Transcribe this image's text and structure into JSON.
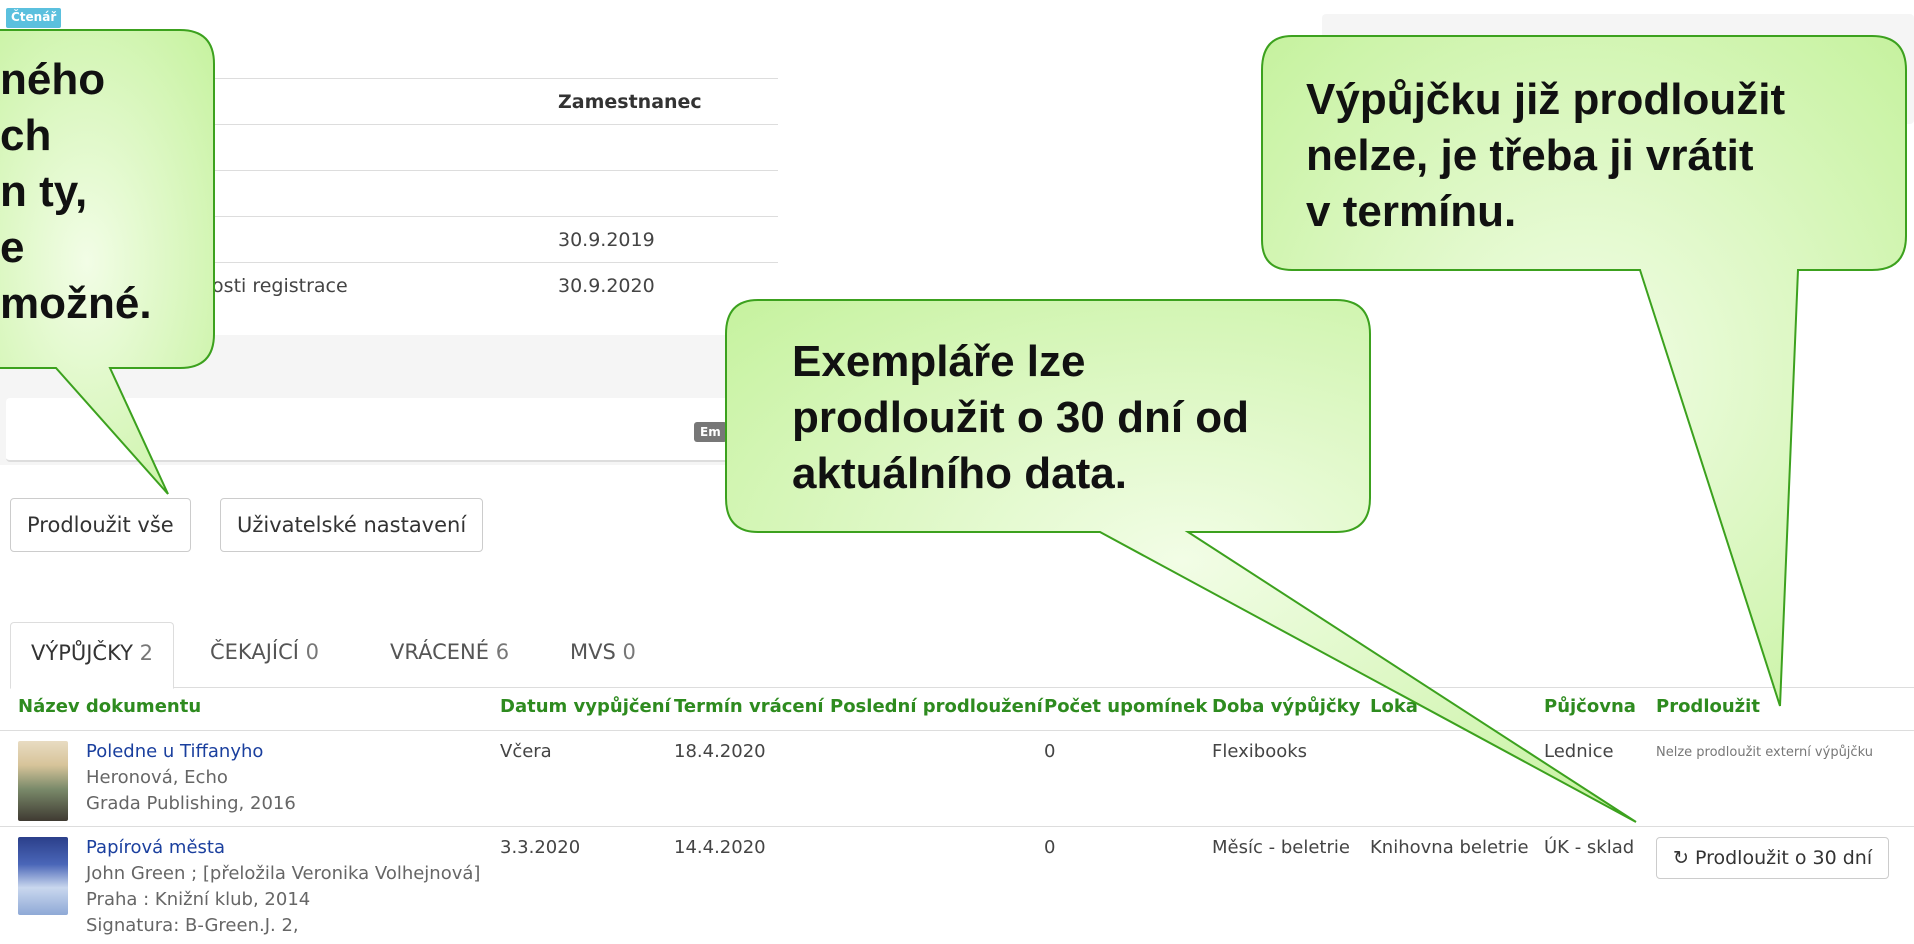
{
  "reader_badge": "Čtenář",
  "info_rows": [
    {
      "label": "",
      "value": "Zamestnanec"
    },
    {
      "label": "",
      "value": ""
    },
    {
      "label": "",
      "value": ""
    },
    {
      "label": "",
      "value": "30.9.2019"
    },
    {
      "label": "nosti registrace",
      "value": "30.9.2020"
    }
  ],
  "email_badge": "Em",
  "buttons": {
    "renew_all": "Prodloužit vše",
    "user_settings": "Uživatelské nastavení"
  },
  "tabs": [
    {
      "label": "VÝPŮJČKY",
      "count": "2"
    },
    {
      "label": "ČEKAJÍCÍ",
      "count": "0"
    },
    {
      "label": "VRÁCENÉ",
      "count": "6"
    },
    {
      "label": "MVS",
      "count": "0"
    }
  ],
  "columns": [
    "Název dokumentu",
    "Datum vypůjčení",
    "Termín vrácení",
    "Poslední prodloužení",
    "Počet upomínek",
    "Doba výpůjčky",
    "Loka",
    "Půjčovna",
    "Prodloužit"
  ],
  "loans": [
    {
      "title": "Poledne u Tiffanyho",
      "lines": [
        "Heronová, Echo",
        "Grada Publishing, 2016"
      ],
      "borrowed": "Včera",
      "due": "18.4.2020",
      "last_renewal": "",
      "reminders": "0",
      "period": "Flexibooks",
      "location": "",
      "branch": "Lednice",
      "renew_note": "Nelze prodloužit externí výpůjčku"
    },
    {
      "title": "Papírová města",
      "lines": [
        "John Green ; [přeložila Veronika Volhejnová]",
        "Praha : Knižní klub, 2014",
        "Signatura: B-Green.J. 2,"
      ],
      "borrowed": "3.3.2020",
      "due": "14.4.2020",
      "last_renewal": "",
      "reminders": "0",
      "period": "Měsíc - beletrie",
      "location": "Knihovna beletrie",
      "branch": "ÚK - sklad",
      "renew_button": "Prodloužit o 30 dní"
    }
  ],
  "callouts": {
    "left": [
      "ného",
      "ch",
      "n ty,",
      "e",
      " možné."
    ],
    "middle": [
      "Exempláře lze",
      "prodloužit o 30 dní od",
      "aktuálního data."
    ],
    "right": [
      "Výpůjčku již prodloužit",
      "nelze, je třeba ji vrátit",
      "v termínu."
    ]
  },
  "colors": {
    "accent_green": "#2e8b1f",
    "callout_fill": "#ccf5a8",
    "callout_border": "#3ca11e",
    "link_blue": "#1a3f9e"
  },
  "icons": {
    "renew": "refresh-icon"
  }
}
